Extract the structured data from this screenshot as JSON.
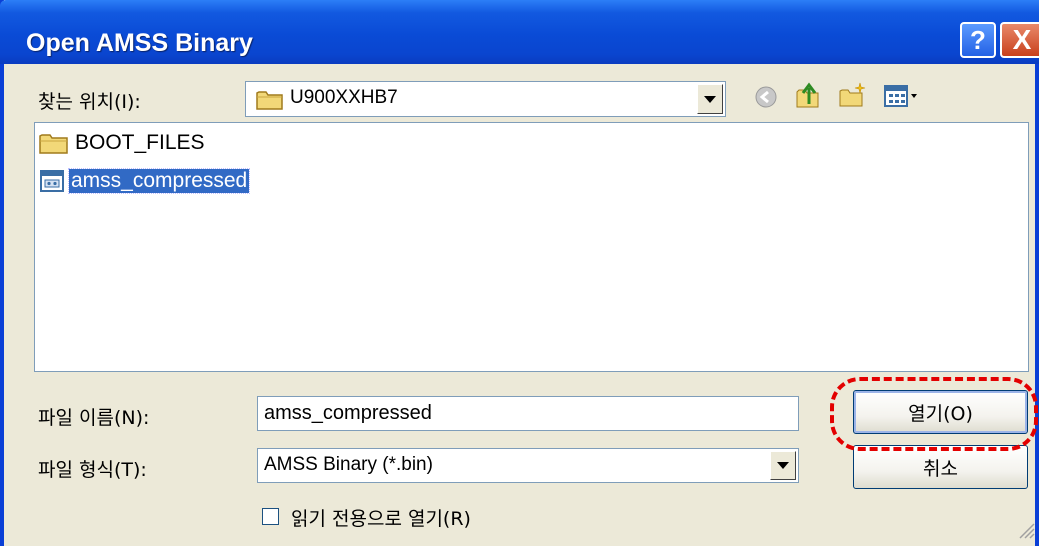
{
  "window": {
    "title": "Open AMSS Binary",
    "help_label": "?",
    "close_label": "X"
  },
  "look_in": {
    "label": "찾는 위치(I):",
    "value": "U900XXHB7"
  },
  "toolbar_icons": [
    "back-icon",
    "up-folder-icon",
    "new-folder-icon",
    "view-menu-icon"
  ],
  "files": [
    {
      "name": "BOOT_FILES",
      "icon": "folder-icon",
      "selected": false
    },
    {
      "name": "amss_compressed",
      "icon": "binary-file-icon",
      "selected": true
    }
  ],
  "filename": {
    "label": "파일 이름(N):",
    "value": "amss_compressed"
  },
  "filetype": {
    "label": "파일 형식(T):",
    "value": "AMSS Binary (*.bin)"
  },
  "readonly": {
    "label": "읽기 전용으로 열기(R)",
    "checked": false
  },
  "buttons": {
    "open": "열기(O)",
    "cancel": "취소"
  },
  "colors": {
    "titlebar": "#0a4bd6",
    "selection": "#316ac5",
    "annotation": "#e30000"
  }
}
